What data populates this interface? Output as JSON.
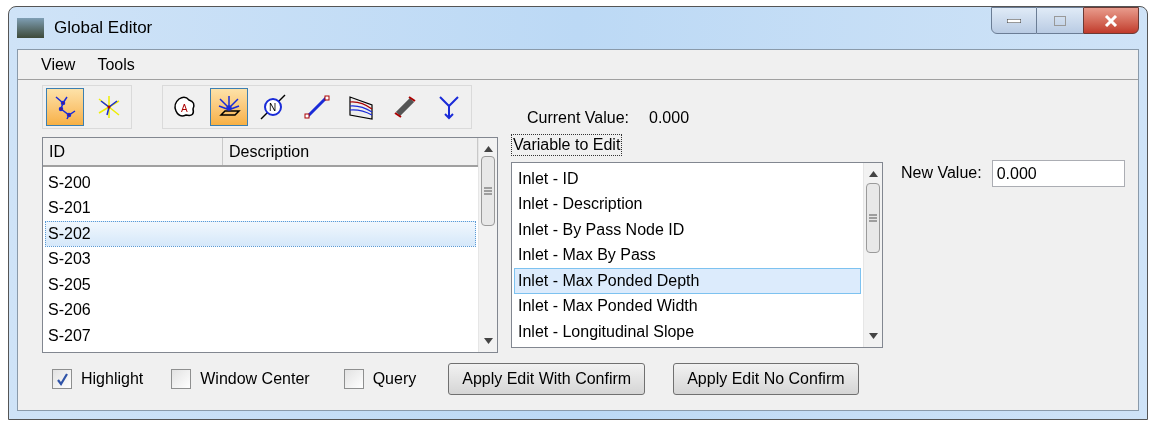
{
  "window": {
    "title": "Global Editor"
  },
  "menu": [
    "View",
    "Tools"
  ],
  "toolbar_groups": [
    {
      "tools": [
        {
          "kind": "network",
          "selected": true
        },
        {
          "kind": "network-alt",
          "selected": false
        }
      ]
    },
    {
      "tools": [
        {
          "kind": "area",
          "selected": false,
          "glyph": "A"
        },
        {
          "kind": "inlet",
          "selected": true
        },
        {
          "kind": "node",
          "selected": false,
          "glyph": "N"
        },
        {
          "kind": "link",
          "selected": false
        },
        {
          "kind": "section",
          "selected": false
        },
        {
          "kind": "pipe",
          "selected": false
        },
        {
          "kind": "junction",
          "selected": false
        }
      ]
    }
  ],
  "current_value": {
    "label": "Current Value:",
    "value": "0.000"
  },
  "id_list": {
    "columns": [
      "ID",
      "Description"
    ],
    "rows": [
      {
        "id": "S-200",
        "selected": false
      },
      {
        "id": "S-201",
        "selected": false
      },
      {
        "id": "S-202",
        "selected": true
      },
      {
        "id": "S-203",
        "selected": false
      },
      {
        "id": "S-205",
        "selected": false
      },
      {
        "id": "S-206",
        "selected": false
      },
      {
        "id": "S-207",
        "selected": false
      }
    ]
  },
  "variable_list": {
    "label": "Variable to Edit",
    "items": [
      {
        "label": "Inlet - ID",
        "selected": false
      },
      {
        "label": "Inlet - Description",
        "selected": false
      },
      {
        "label": "Inlet - By Pass Node ID",
        "selected": false
      },
      {
        "label": "Inlet - Max By Pass",
        "selected": false
      },
      {
        "label": "Inlet - Max Ponded Depth",
        "selected": true
      },
      {
        "label": "Inlet - Max Ponded Width",
        "selected": false
      },
      {
        "label": "Inlet - Longitudinal Slope",
        "selected": false
      }
    ]
  },
  "new_value": {
    "label": "New Value:",
    "value": "0.000"
  },
  "checkboxes": [
    {
      "label": "Highlight",
      "checked": true
    },
    {
      "label": "Window Center",
      "checked": false
    },
    {
      "label": "Query",
      "checked": false
    }
  ],
  "buttons": [
    "Apply Edit With Confirm",
    "Apply Edit No Confirm"
  ]
}
